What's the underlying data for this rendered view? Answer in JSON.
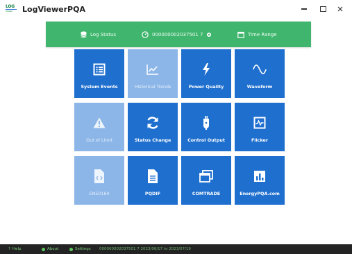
{
  "window": {
    "title": "LogViewerPQA",
    "logo_top": "LOG",
    "logo_bottom": "Viewer"
  },
  "status_bar": {
    "log_status_label": "Log Status",
    "device_id": "000000002037501 7",
    "time_range_label": "Time Range"
  },
  "tiles": [
    {
      "label": "System Events",
      "icon": "list-icon",
      "enabled": true
    },
    {
      "label": "Historical Trends",
      "icon": "trend-chart-icon",
      "enabled": false
    },
    {
      "label": "Power Quality",
      "icon": "lightning-icon",
      "enabled": true
    },
    {
      "label": "Waveform",
      "icon": "sine-wave-icon",
      "enabled": true
    },
    {
      "label": "Out of Limit",
      "icon": "warning-icon",
      "enabled": false
    },
    {
      "label": "Status Change",
      "icon": "refresh-icon",
      "enabled": true
    },
    {
      "label": "Control Output",
      "icon": "plug-icon",
      "enabled": true
    },
    {
      "label": "Flicker",
      "icon": "flicker-icon",
      "enabled": true
    },
    {
      "label": "EN50160",
      "icon": "code-file-icon",
      "enabled": false
    },
    {
      "label": "PQDIF",
      "icon": "document-icon",
      "enabled": true
    },
    {
      "label": "COMTRADE",
      "icon": "window-copy-icon",
      "enabled": true
    },
    {
      "label": "EnergyPQA.com",
      "icon": "bar-chart-icon",
      "enabled": true
    }
  ],
  "footer": {
    "help": "Help",
    "about": "About",
    "settings": "Settings",
    "info": "000000002037501 7  2023/06/17 to 2023/07/19"
  },
  "colors": {
    "status_bar_green": "#3fb56d",
    "tile_blue": "#1f6fcf",
    "tile_disabled": "#8db6e8",
    "footer_bg": "#232323"
  }
}
